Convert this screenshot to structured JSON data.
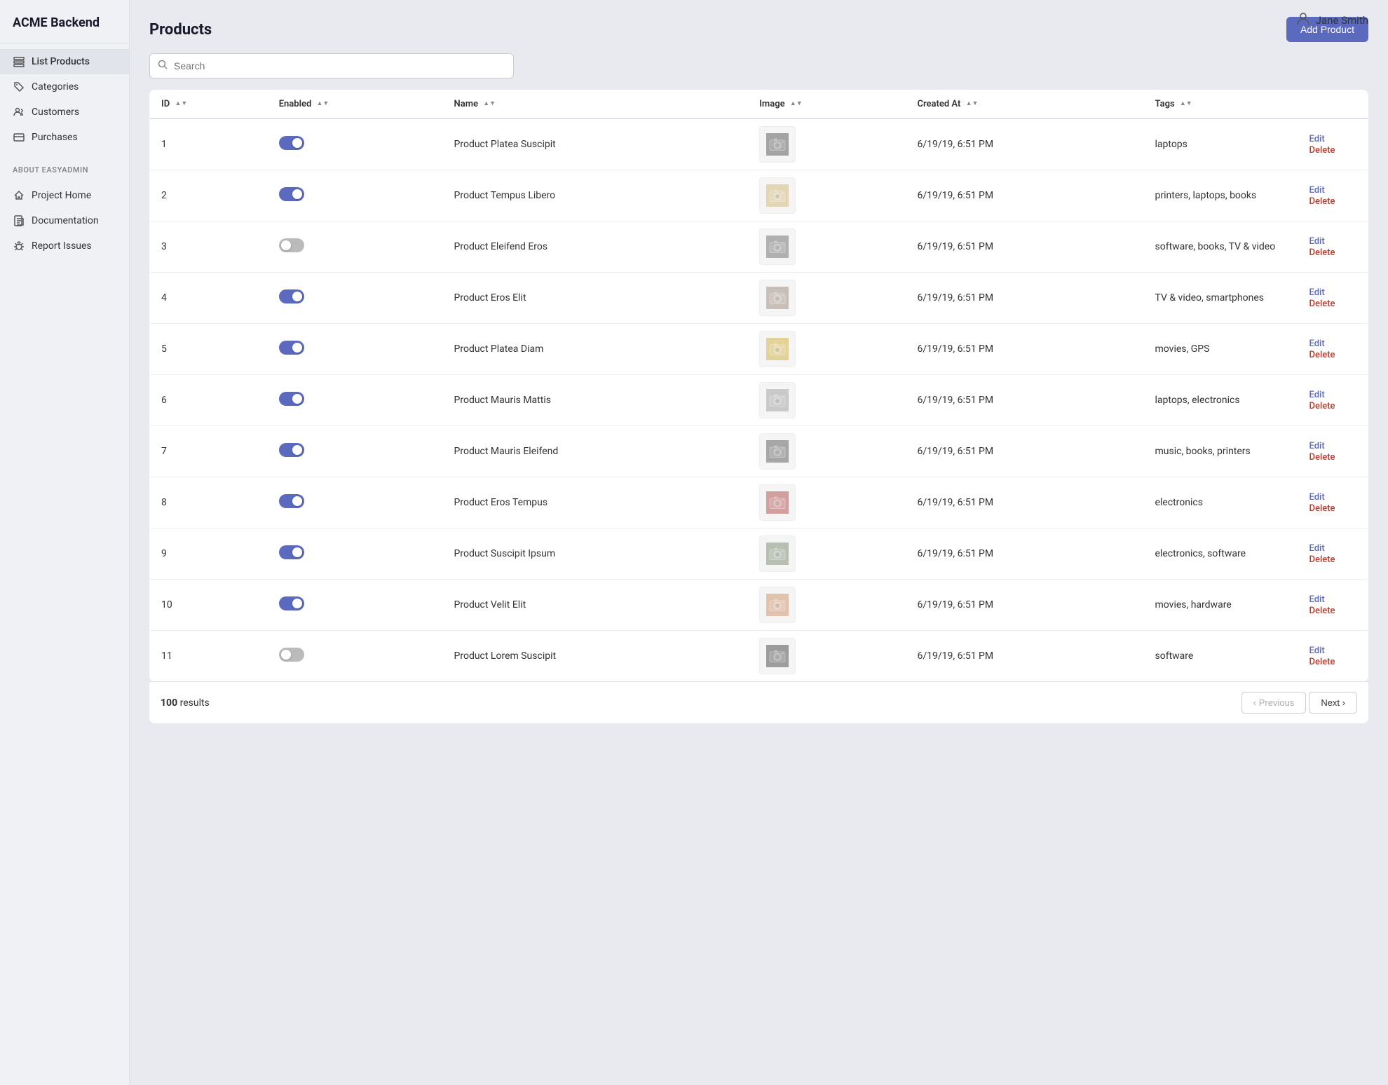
{
  "app": {
    "title": "ACME Backend"
  },
  "topbar": {
    "user_name": "Jane Smith"
  },
  "sidebar": {
    "nav_items": [
      {
        "id": "list-products",
        "label": "List Products",
        "icon": "list-icon",
        "active": true
      },
      {
        "id": "categories",
        "label": "Categories",
        "icon": "tag-icon",
        "active": false
      },
      {
        "id": "customers",
        "label": "Customers",
        "icon": "users-icon",
        "active": false
      },
      {
        "id": "purchases",
        "label": "Purchases",
        "icon": "card-icon",
        "active": false
      }
    ],
    "about_section_label": "ABOUT EASYADMIN",
    "about_items": [
      {
        "id": "project-home",
        "label": "Project Home",
        "icon": "home-icon"
      },
      {
        "id": "documentation",
        "label": "Documentation",
        "icon": "doc-icon"
      },
      {
        "id": "report-issues",
        "label": "Report Issues",
        "icon": "bug-icon"
      }
    ]
  },
  "page": {
    "title": "Products",
    "add_button_label": "Add Product",
    "search_placeholder": "Search"
  },
  "table": {
    "columns": [
      {
        "id": "id",
        "label": "ID"
      },
      {
        "id": "enabled",
        "label": "Enabled"
      },
      {
        "id": "name",
        "label": "Name"
      },
      {
        "id": "image",
        "label": "Image"
      },
      {
        "id": "created_at",
        "label": "Created At"
      },
      {
        "id": "tags",
        "label": "Tags"
      }
    ],
    "rows": [
      {
        "id": 1,
        "enabled": true,
        "name": "Product Platea Suscipit",
        "created_at": "6/19/19, 6:51 PM",
        "tags": "laptops",
        "cam_class": "cam-bg-1"
      },
      {
        "id": 2,
        "enabled": true,
        "name": "Product Tempus Libero",
        "created_at": "6/19/19, 6:51 PM",
        "tags": "printers, laptops, books",
        "cam_class": "cam-bg-2"
      },
      {
        "id": 3,
        "enabled": false,
        "name": "Product Eleifend Eros",
        "created_at": "6/19/19, 6:51 PM",
        "tags": "software, books, TV & video",
        "cam_class": "cam-bg-3"
      },
      {
        "id": 4,
        "enabled": true,
        "name": "Product Eros Elit",
        "created_at": "6/19/19, 6:51 PM",
        "tags": "TV & video, smartphones",
        "cam_class": "cam-bg-4"
      },
      {
        "id": 5,
        "enabled": true,
        "name": "Product Platea Diam",
        "created_at": "6/19/19, 6:51 PM",
        "tags": "movies, GPS",
        "cam_class": "cam-bg-5"
      },
      {
        "id": 6,
        "enabled": true,
        "name": "Product Mauris Mattis",
        "created_at": "6/19/19, 6:51 PM",
        "tags": "laptops, electronics",
        "cam_class": "cam-bg-6"
      },
      {
        "id": 7,
        "enabled": true,
        "name": "Product Mauris Eleifend",
        "created_at": "6/19/19, 6:51 PM",
        "tags": "music, books, printers",
        "cam_class": "cam-bg-7"
      },
      {
        "id": 8,
        "enabled": true,
        "name": "Product Eros Tempus",
        "created_at": "6/19/19, 6:51 PM",
        "tags": "electronics",
        "cam_class": "cam-bg-8"
      },
      {
        "id": 9,
        "enabled": true,
        "name": "Product Suscipit Ipsum",
        "created_at": "6/19/19, 6:51 PM",
        "tags": "electronics, software",
        "cam_class": "cam-bg-9"
      },
      {
        "id": 10,
        "enabled": true,
        "name": "Product Velit Elit",
        "created_at": "6/19/19, 6:51 PM",
        "tags": "movies, hardware",
        "cam_class": "cam-bg-10"
      },
      {
        "id": 11,
        "enabled": false,
        "name": "Product Lorem Suscipit",
        "created_at": "6/19/19, 6:51 PM",
        "tags": "software",
        "cam_class": "cam-bg-11"
      }
    ]
  },
  "footer": {
    "results_count": "100",
    "results_label": "results",
    "prev_label": "Previous",
    "next_label": "Next"
  },
  "actions": {
    "edit_label": "Edit",
    "delete_label": "Delete"
  }
}
